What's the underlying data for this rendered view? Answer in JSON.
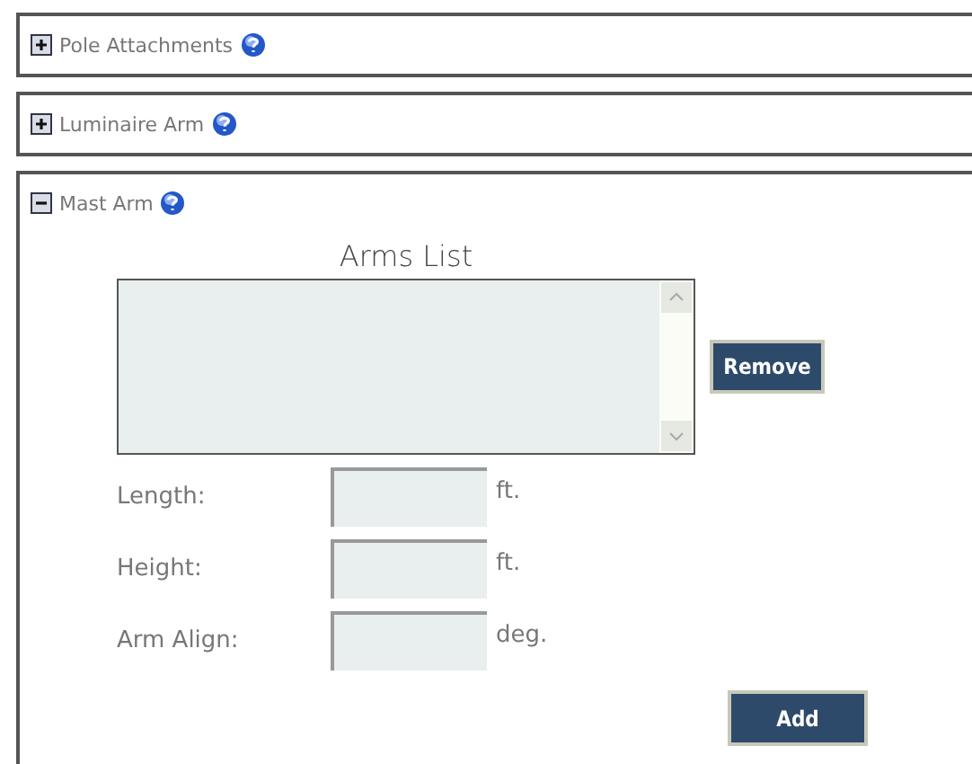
{
  "sections": [
    {
      "title": "Pole Attachments",
      "expanded": false
    },
    {
      "title": "Luminaire Arm",
      "expanded": false
    },
    {
      "title": "Mast Arm",
      "expanded": true
    }
  ],
  "arms_list": {
    "title": "Arms List",
    "remove_button": "Remove"
  },
  "fields": [
    {
      "label": "Length:",
      "unit": "ft."
    },
    {
      "label": "Height:",
      "unit": "ft."
    },
    {
      "label": "Arm Align:",
      "unit": "deg."
    }
  ],
  "add_button": "Add"
}
